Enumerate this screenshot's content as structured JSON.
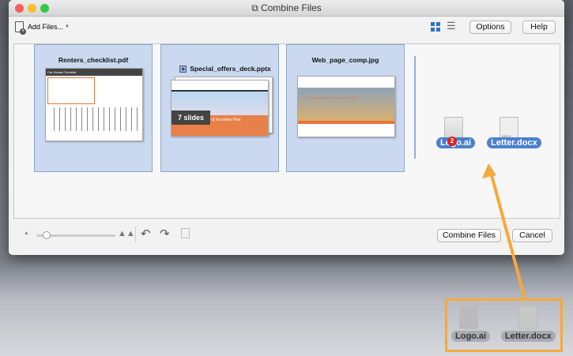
{
  "window": {
    "title": "Combine Files"
  },
  "toolbar": {
    "add_files": "Add Files...",
    "options": "Options",
    "help": "Help"
  },
  "files": [
    {
      "name": "Renters_checklist.pdf",
      "thumb_title": "Car Rental Checklist"
    },
    {
      "name": "Special_offers_deck.pptx",
      "badge": "7 slides",
      "thumb_title": "Survey & Incentive Plan"
    },
    {
      "name": "Web_page_comp.jpg",
      "thumb_title": "The world awaits. Here are the keys."
    }
  ],
  "dragging": {
    "items": [
      "Logo.ai",
      "Letter.docx"
    ],
    "count": "2",
    "docx_label": "DOCX"
  },
  "desktop": {
    "items": [
      "Logo.ai",
      "Letter.docx"
    ]
  },
  "footer": {
    "combine": "Combine Files",
    "cancel": "Cancel"
  },
  "colors": {
    "selection": "#cbd9f0",
    "accent": "#4a7fd0",
    "annotation": "#f5a93a"
  }
}
